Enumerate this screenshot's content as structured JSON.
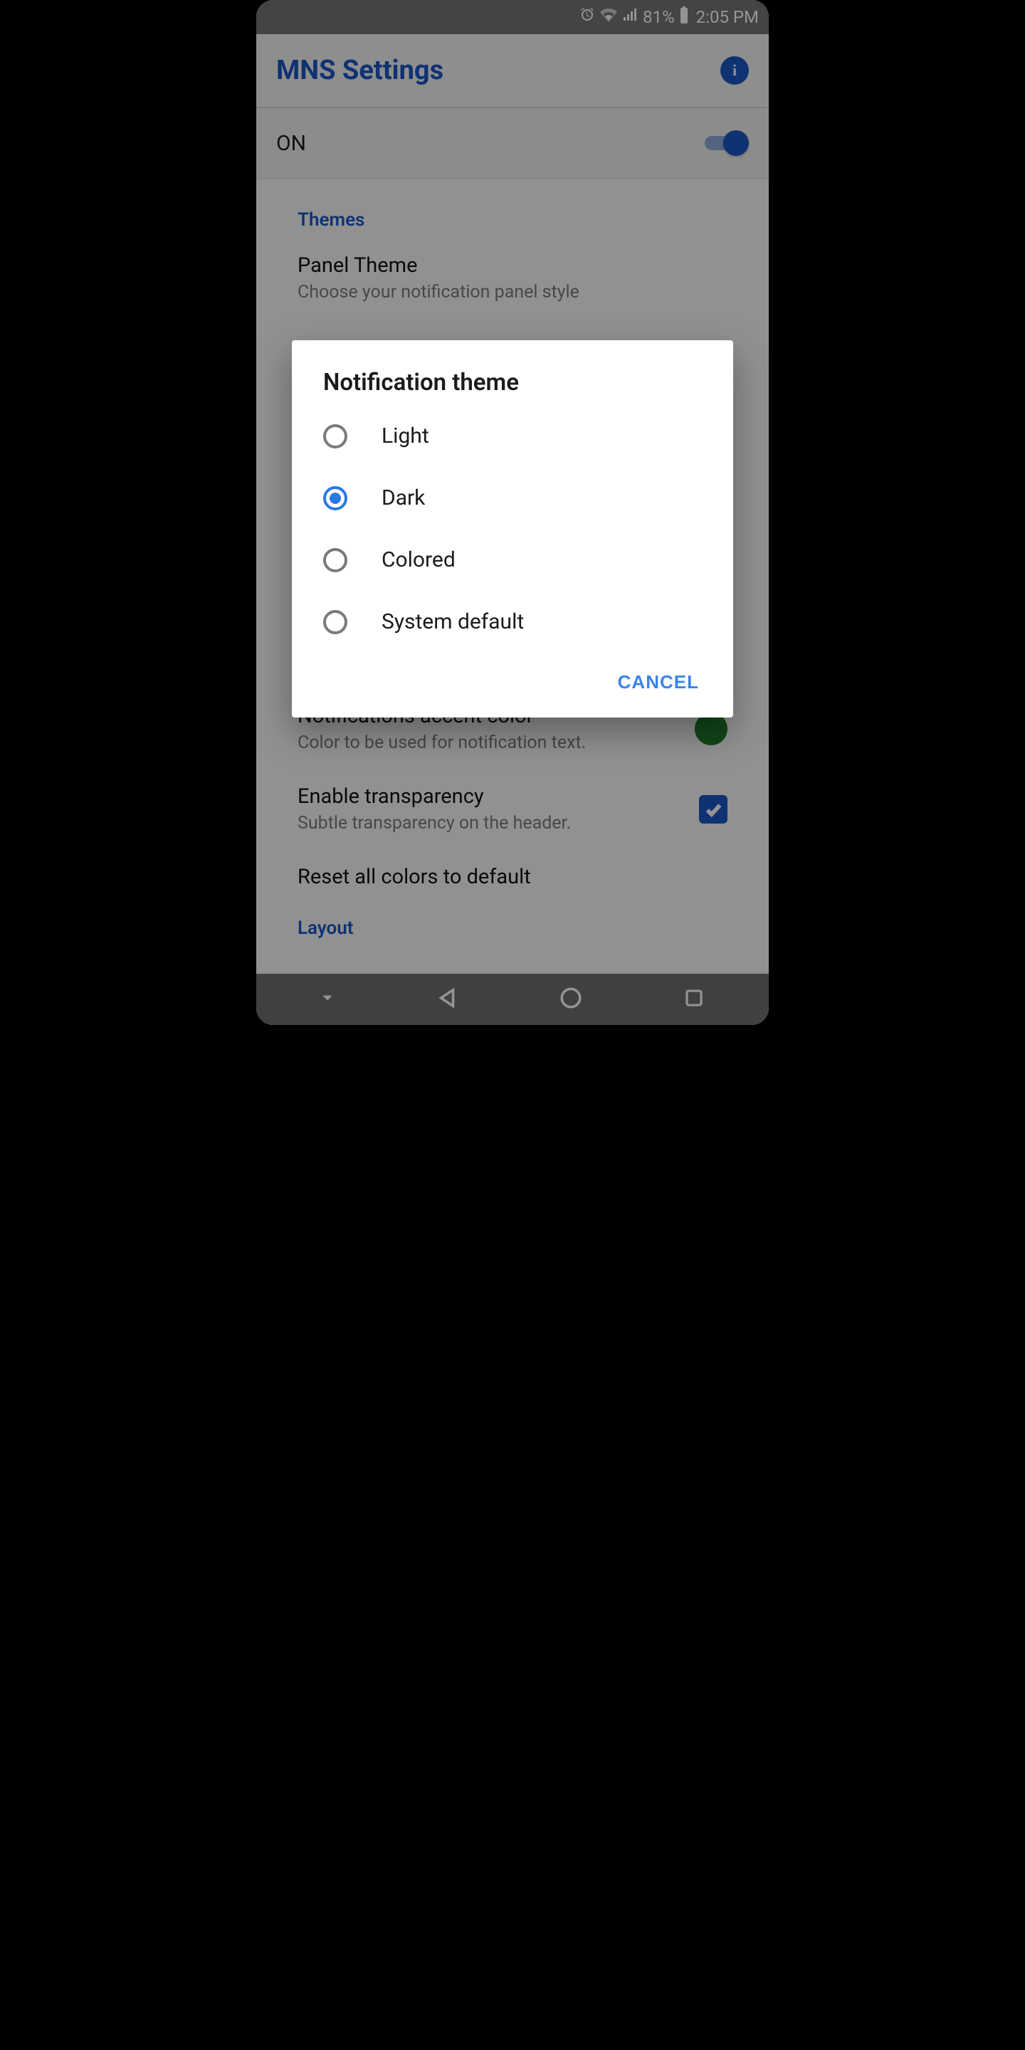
{
  "status": {
    "battery_pct": "81%",
    "time": "2:05 PM"
  },
  "header": {
    "title": "MNS Settings"
  },
  "master": {
    "label": "ON",
    "on": true
  },
  "sections": {
    "themes_header": "Themes",
    "panel_theme": {
      "title": "Panel Theme",
      "subtitle": "Choose your notification panel style"
    },
    "accent": {
      "title": "Notifications accent color",
      "subtitle": "Color to be used for notification text.",
      "color": "#1e7a2e"
    },
    "transparency": {
      "title": "Enable transparency",
      "subtitle": "Subtle transparency on the header.",
      "checked": true
    },
    "reset": {
      "title": "Reset all colors to default"
    },
    "layout_header": "Layout"
  },
  "dialog": {
    "title": "Notification theme",
    "options": [
      "Light",
      "Dark",
      "Colored",
      "System default"
    ],
    "selected_index": 1,
    "cancel": "CANCEL"
  }
}
